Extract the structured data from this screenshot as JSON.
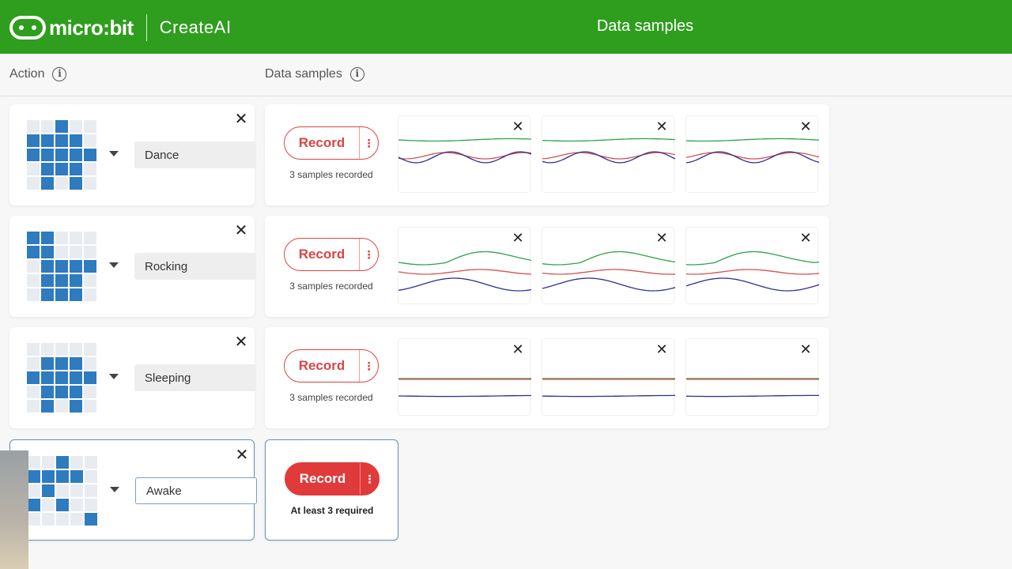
{
  "header": {
    "logo_text": "micro:bit",
    "logo_sub": "CreateAI",
    "title": "Data samples"
  },
  "columns": {
    "action_label": "Action",
    "samples_label": "Data samples"
  },
  "actions": [
    {
      "name": "Dance",
      "grid": [
        0,
        0,
        1,
        0,
        0,
        1,
        1,
        1,
        1,
        0,
        1,
        1,
        1,
        1,
        1,
        0,
        1,
        1,
        1,
        0,
        0,
        1,
        0,
        1,
        0
      ],
      "record_label": "Record",
      "status": "3 samples recorded"
    },
    {
      "name": "Rocking",
      "grid": [
        1,
        1,
        0,
        0,
        0,
        1,
        1,
        0,
        0,
        0,
        0,
        1,
        1,
        1,
        1,
        0,
        1,
        1,
        1,
        0,
        0,
        1,
        1,
        1,
        0
      ],
      "record_label": "Record",
      "status": "3 samples recorded"
    },
    {
      "name": "Sleeping",
      "grid": [
        0,
        0,
        0,
        0,
        0,
        0,
        1,
        1,
        1,
        0,
        1,
        1,
        1,
        1,
        1,
        0,
        1,
        1,
        1,
        0,
        0,
        1,
        0,
        1,
        0
      ],
      "record_label": "Record",
      "status": "3 samples recorded"
    },
    {
      "name": "Awake",
      "grid": [
        0,
        0,
        1,
        0,
        0,
        1,
        1,
        1,
        1,
        0,
        0,
        1,
        0,
        0,
        0,
        1,
        0,
        1,
        0,
        0,
        0,
        0,
        0,
        0,
        1
      ],
      "record_label": "Record",
      "status": "At least 3 required"
    }
  ],
  "colors": {
    "x": "#2fa24a",
    "y": "#d95050",
    "z": "#2d2f8f",
    "accent": "#2f9e1e",
    "record": "#d94545"
  }
}
